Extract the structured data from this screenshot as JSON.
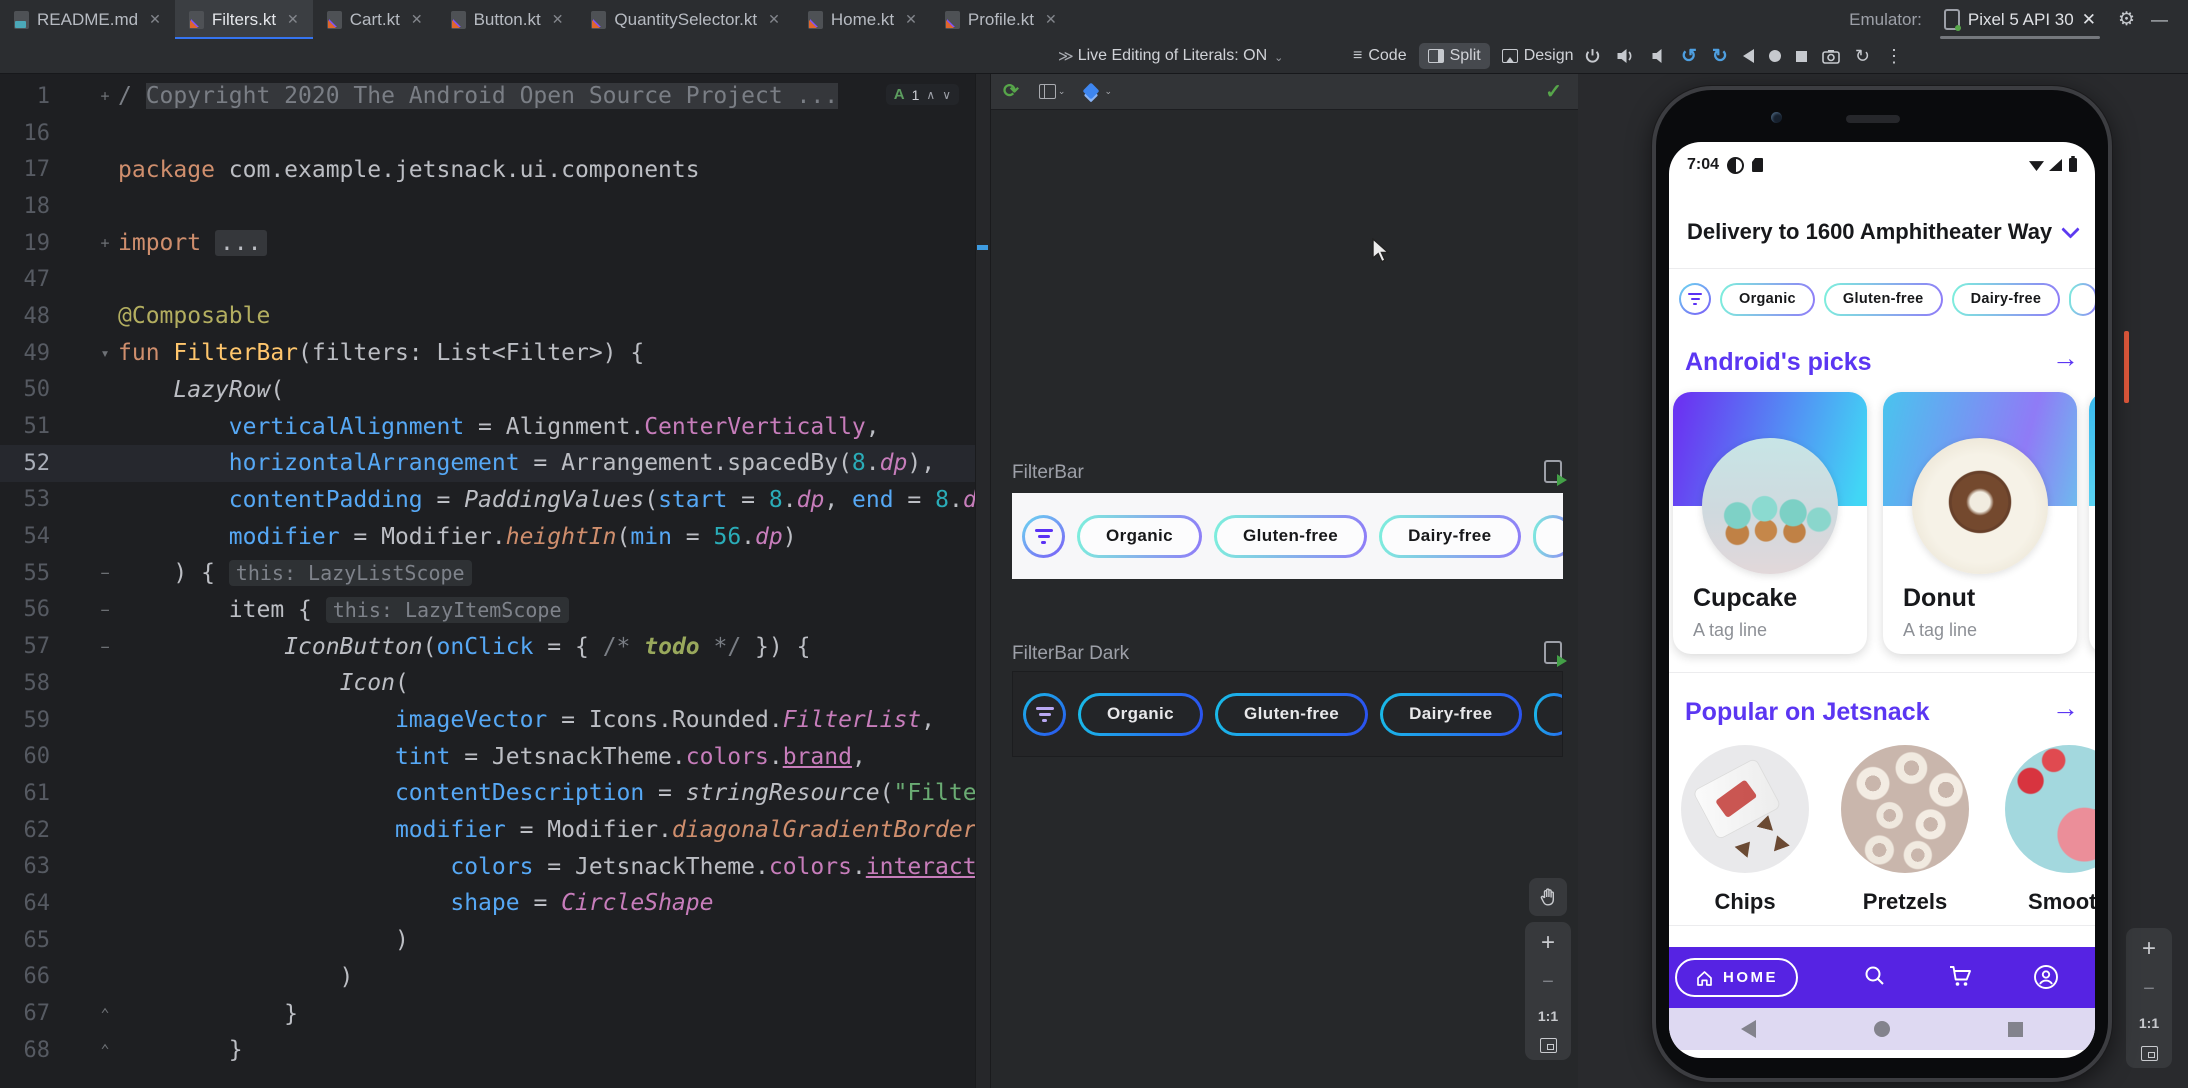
{
  "icons": {
    "close": "✕",
    "gear": "⚙",
    "minimize": "—",
    "chevron_down": "⌄",
    "check": "✓",
    "refresh": "⟳",
    "hamburger": "≡",
    "live_edit": "≫",
    "rotate_left": "↺",
    "rotate_right": "↻",
    "snapshot_rotate": "↻",
    "more": "⋮",
    "plus": "+",
    "minus": "−",
    "actual_size": "1:1",
    "arrow_right": "→",
    "fold_plus": "+",
    "fold_minus": "−",
    "fold_down": "▾",
    "fold_end": "⌃",
    "inspection_icon": "A",
    "up": "∧",
    "down": "∨"
  },
  "editor_tabs": [
    {
      "label": "README.md",
      "type": "md",
      "active": false
    },
    {
      "label": "Filters.kt",
      "type": "kt",
      "active": true
    },
    {
      "label": "Cart.kt",
      "type": "kt",
      "active": false
    },
    {
      "label": "Button.kt",
      "type": "kt",
      "active": false
    },
    {
      "label": "QuantitySelector.kt",
      "type": "kt",
      "active": false
    },
    {
      "label": "Home.kt",
      "type": "kt",
      "active": false
    },
    {
      "label": "Profile.kt",
      "type": "kt",
      "active": false
    }
  ],
  "emulator": {
    "label": "Emulator:",
    "device_tab": "Pixel 5 API 30"
  },
  "toolbar": {
    "live_edit": "Live Editing of Literals: ON",
    "modes": [
      {
        "label": "Code",
        "active": false
      },
      {
        "label": "Split",
        "active": true
      },
      {
        "label": "Design",
        "active": false
      }
    ]
  },
  "editor": {
    "inspection_count": "1",
    "lines": [
      {
        "n": "1",
        "fold": "plus",
        "s": [
          [
            "/ ",
            "cmt"
          ],
          [
            "Copyright 2020 The Android Open Source Project ...",
            "cmt foldbg"
          ]
        ]
      },
      {
        "n": "16",
        "s": []
      },
      {
        "n": "17",
        "s": [
          [
            "package",
            "kw"
          ],
          [
            " com.example.jetsnack.ui.components",
            "pl"
          ]
        ]
      },
      {
        "n": "18",
        "s": []
      },
      {
        "n": "19",
        "fold": "plus",
        "s": [
          [
            "import",
            "kw"
          ],
          [
            " ",
            "pl"
          ],
          [
            "...",
            "foldchip"
          ]
        ]
      },
      {
        "n": "47",
        "s": []
      },
      {
        "n": "48",
        "s": [
          [
            "@Composable",
            "ann"
          ]
        ]
      },
      {
        "n": "49",
        "fold": "down",
        "s": [
          [
            "fun",
            "kw"
          ],
          [
            " ",
            "pl"
          ],
          [
            "FilterBar",
            "fn"
          ],
          [
            "(filters: List<Filter>) {",
            "pl"
          ]
        ]
      },
      {
        "n": "50",
        "s": [
          [
            "    ",
            "pl"
          ],
          [
            "LazyRow",
            "call"
          ],
          [
            "(",
            "pl"
          ]
        ]
      },
      {
        "n": "51",
        "s": [
          [
            "        ",
            "pl"
          ],
          [
            "verticalAlignment",
            "arg"
          ],
          [
            " = Alignment.",
            "pl"
          ],
          [
            "CenterVertically",
            "prop"
          ],
          [
            ",",
            "pl"
          ]
        ]
      },
      {
        "n": "52",
        "cur": true,
        "s": [
          [
            "        ",
            "pl"
          ],
          [
            "horizontalArrangement",
            "arg"
          ],
          [
            " = Arrangement.spacedBy(",
            "pl"
          ],
          [
            "8",
            "num"
          ],
          [
            ".",
            "pl"
          ],
          [
            "dp",
            "propi"
          ],
          [
            "),",
            "pl"
          ]
        ]
      },
      {
        "n": "53",
        "s": [
          [
            "        ",
            "pl"
          ],
          [
            "contentPadding",
            "arg"
          ],
          [
            " = ",
            "pl"
          ],
          [
            "PaddingValues",
            "call"
          ],
          [
            "(",
            "pl"
          ],
          [
            "start",
            "arg"
          ],
          [
            " = ",
            "pl"
          ],
          [
            "8",
            "num"
          ],
          [
            ".",
            "pl"
          ],
          [
            "dp",
            "propi"
          ],
          [
            ", ",
            "pl"
          ],
          [
            "end",
            "arg"
          ],
          [
            " = ",
            "pl"
          ],
          [
            "8",
            "num"
          ],
          [
            ".",
            "pl"
          ],
          [
            "dp",
            "propi"
          ],
          [
            ",",
            "pl"
          ]
        ]
      },
      {
        "n": "54",
        "s": [
          [
            "        ",
            "pl"
          ],
          [
            "modifier",
            "arg"
          ],
          [
            " = Modifier.",
            "pl"
          ],
          [
            "heightIn",
            "ext"
          ],
          [
            "(",
            "pl"
          ],
          [
            "min",
            "arg"
          ],
          [
            " = ",
            "pl"
          ],
          [
            "56",
            "num"
          ],
          [
            ".",
            "pl"
          ],
          [
            "dp",
            "propi"
          ],
          [
            ")",
            "pl"
          ]
        ]
      },
      {
        "n": "55",
        "fold": "minus",
        "s": [
          [
            "    ) { ",
            "pl"
          ],
          [
            "this: LazyListScope",
            "hint"
          ]
        ]
      },
      {
        "n": "56",
        "fold": "minus",
        "s": [
          [
            "        item { ",
            "pl"
          ],
          [
            "this: LazyItemScope",
            "hint"
          ]
        ]
      },
      {
        "n": "57",
        "fold": "minus",
        "s": [
          [
            "            ",
            "pl"
          ],
          [
            "IconButton",
            "call"
          ],
          [
            "(",
            "pl"
          ],
          [
            "onClick",
            "arg"
          ],
          [
            " = { ",
            "pl"
          ],
          [
            "/* ",
            "cmt"
          ],
          [
            "todo",
            "todo"
          ],
          [
            " */",
            "cmt"
          ],
          [
            " }) {",
            "pl"
          ]
        ]
      },
      {
        "n": "58",
        "s": [
          [
            "                ",
            "pl"
          ],
          [
            "Icon",
            "call"
          ],
          [
            "(",
            "pl"
          ]
        ]
      },
      {
        "n": "59",
        "s": [
          [
            "                    ",
            "pl"
          ],
          [
            "imageVector",
            "arg"
          ],
          [
            " = Icons.Rounded.",
            "pl"
          ],
          [
            "FilterList",
            "propi"
          ],
          [
            ",",
            "pl"
          ]
        ]
      },
      {
        "n": "60",
        "s": [
          [
            "                    ",
            "pl"
          ],
          [
            "tint",
            "arg"
          ],
          [
            " = JetsnackTheme.",
            "pl"
          ],
          [
            "colors",
            "prop"
          ],
          [
            ".",
            "pl"
          ],
          [
            "brand",
            "propu"
          ],
          [
            ",",
            "pl"
          ]
        ]
      },
      {
        "n": "61",
        "s": [
          [
            "                    ",
            "pl"
          ],
          [
            "contentDescription",
            "arg"
          ],
          [
            " = ",
            "pl"
          ],
          [
            "stringResource",
            "call"
          ],
          [
            "(",
            "pl"
          ],
          [
            "\"Filter list\"",
            "str"
          ],
          [
            ")",
            "pl"
          ]
        ]
      },
      {
        "n": "62",
        "s": [
          [
            "                    ",
            "pl"
          ],
          [
            "modifier",
            "arg"
          ],
          [
            " = Modifier.",
            "pl"
          ],
          [
            "diagonalGradientBorder",
            "ext"
          ]
        ]
      },
      {
        "n": "63",
        "s": [
          [
            "                        ",
            "pl"
          ],
          [
            "colors",
            "arg"
          ],
          [
            " = JetsnackTheme.",
            "pl"
          ],
          [
            "colors",
            "prop"
          ],
          [
            ".",
            "pl"
          ],
          [
            "interactiveSeconda",
            "propu"
          ]
        ]
      },
      {
        "n": "64",
        "s": [
          [
            "                        ",
            "pl"
          ],
          [
            "shape",
            "arg"
          ],
          [
            " = ",
            "pl"
          ],
          [
            "CircleShape",
            "propi"
          ]
        ]
      },
      {
        "n": "65",
        "s": [
          [
            "                    )",
            "pl"
          ]
        ]
      },
      {
        "n": "66",
        "s": [
          [
            "                )",
            "pl"
          ]
        ]
      },
      {
        "n": "67",
        "fold": "end",
        "s": [
          [
            "            }",
            "pl"
          ]
        ]
      },
      {
        "n": "68",
        "fold": "end",
        "s": [
          [
            "        }",
            "pl"
          ]
        ]
      }
    ]
  },
  "preview": {
    "panels": [
      {
        "label": "FilterBar",
        "theme": "light"
      },
      {
        "label": "FilterBar Dark",
        "theme": "dark"
      }
    ],
    "chips": [
      "Organic",
      "Gluten-free",
      "Dairy-free"
    ]
  },
  "phone": {
    "time": "7:04",
    "delivery": "Delivery to 1600 Amphitheater Way",
    "filter_chips": [
      "Organic",
      "Gluten-free",
      "Dairy-free"
    ],
    "picks": {
      "title": "Android's picks",
      "cards": [
        {
          "name": "Cupcake",
          "tagline": "A tag line",
          "photo": "cupcake"
        },
        {
          "name": "Donut",
          "tagline": "A tag line",
          "photo": "donut"
        }
      ]
    },
    "popular": {
      "title": "Popular on Jetsnack",
      "snacks": [
        {
          "name": "Chips",
          "photo": "chips"
        },
        {
          "name": "Pretzels",
          "photo": "pretzels"
        },
        {
          "name": "Smooth",
          "photo": "smoothie"
        }
      ]
    },
    "nav": {
      "home": "HOME"
    }
  },
  "colors": {
    "brand_purple": "#5B36F2",
    "navbar_purple": "#5623E3",
    "tab_accent": "#3574F0",
    "chip_gradient_light": [
      "#7DF0DC",
      "#8F7BF8"
    ],
    "chip_gradient_dark": [
      "#19BCE8",
      "#2B50F0"
    ],
    "status_orange": "#E2593C"
  }
}
